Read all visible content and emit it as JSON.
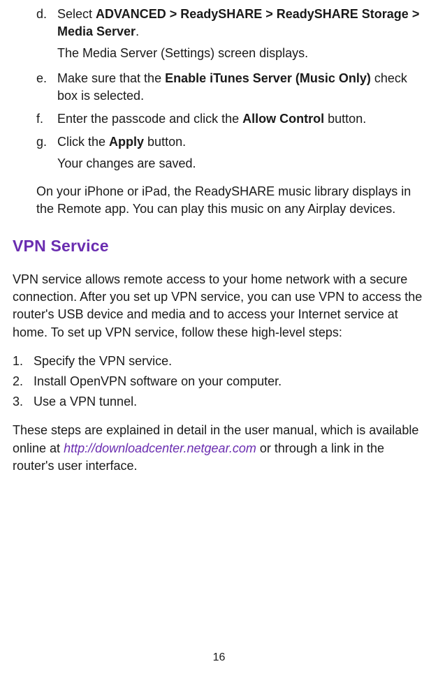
{
  "steps": {
    "d": {
      "marker": "d.",
      "prefix": "Select ",
      "bold": "ADVANCED > ReadySHARE > ReadySHARE Storage > Media Server",
      "suffix": ".",
      "followup": "The Media Server (Settings) screen displays."
    },
    "e": {
      "marker": "e.",
      "prefix": "Make sure that the ",
      "bold": "Enable iTunes Server (Music Only)",
      "suffix": " check box is selected."
    },
    "f": {
      "marker": "f.",
      "prefix": "Enter the passcode and click the ",
      "bold": "Allow Control",
      "suffix": " button."
    },
    "g": {
      "marker": "g.",
      "prefix": "Click the ",
      "bold": "Apply",
      "suffix": " button.",
      "followup": "Your changes are saved."
    }
  },
  "closing_para": "On your iPhone or iPad, the ReadySHARE music library displays in the Remote app. You can play this music on any Airplay devices.",
  "section": {
    "heading": "VPN Service",
    "intro": "VPN service allows remote access to your home network with a secure connection. After you set up VPN service, you can use VPN to access the router's USB device and media and to access your Internet service at home. To set up VPN service, follow these high-level steps:",
    "list": [
      {
        "marker": "1.",
        "text": "Specify the VPN service."
      },
      {
        "marker": "2.",
        "text": "Install OpenVPN software on your computer."
      },
      {
        "marker": "3.",
        "text": "Use a VPN tunnel."
      }
    ],
    "outro_1": "These steps are explained in detail in the user manual, which is available online at ",
    "outro_link": "http://downloadcenter.netgear.com",
    "outro_2": " or through a link in the router's user interface."
  },
  "page_number": "16"
}
